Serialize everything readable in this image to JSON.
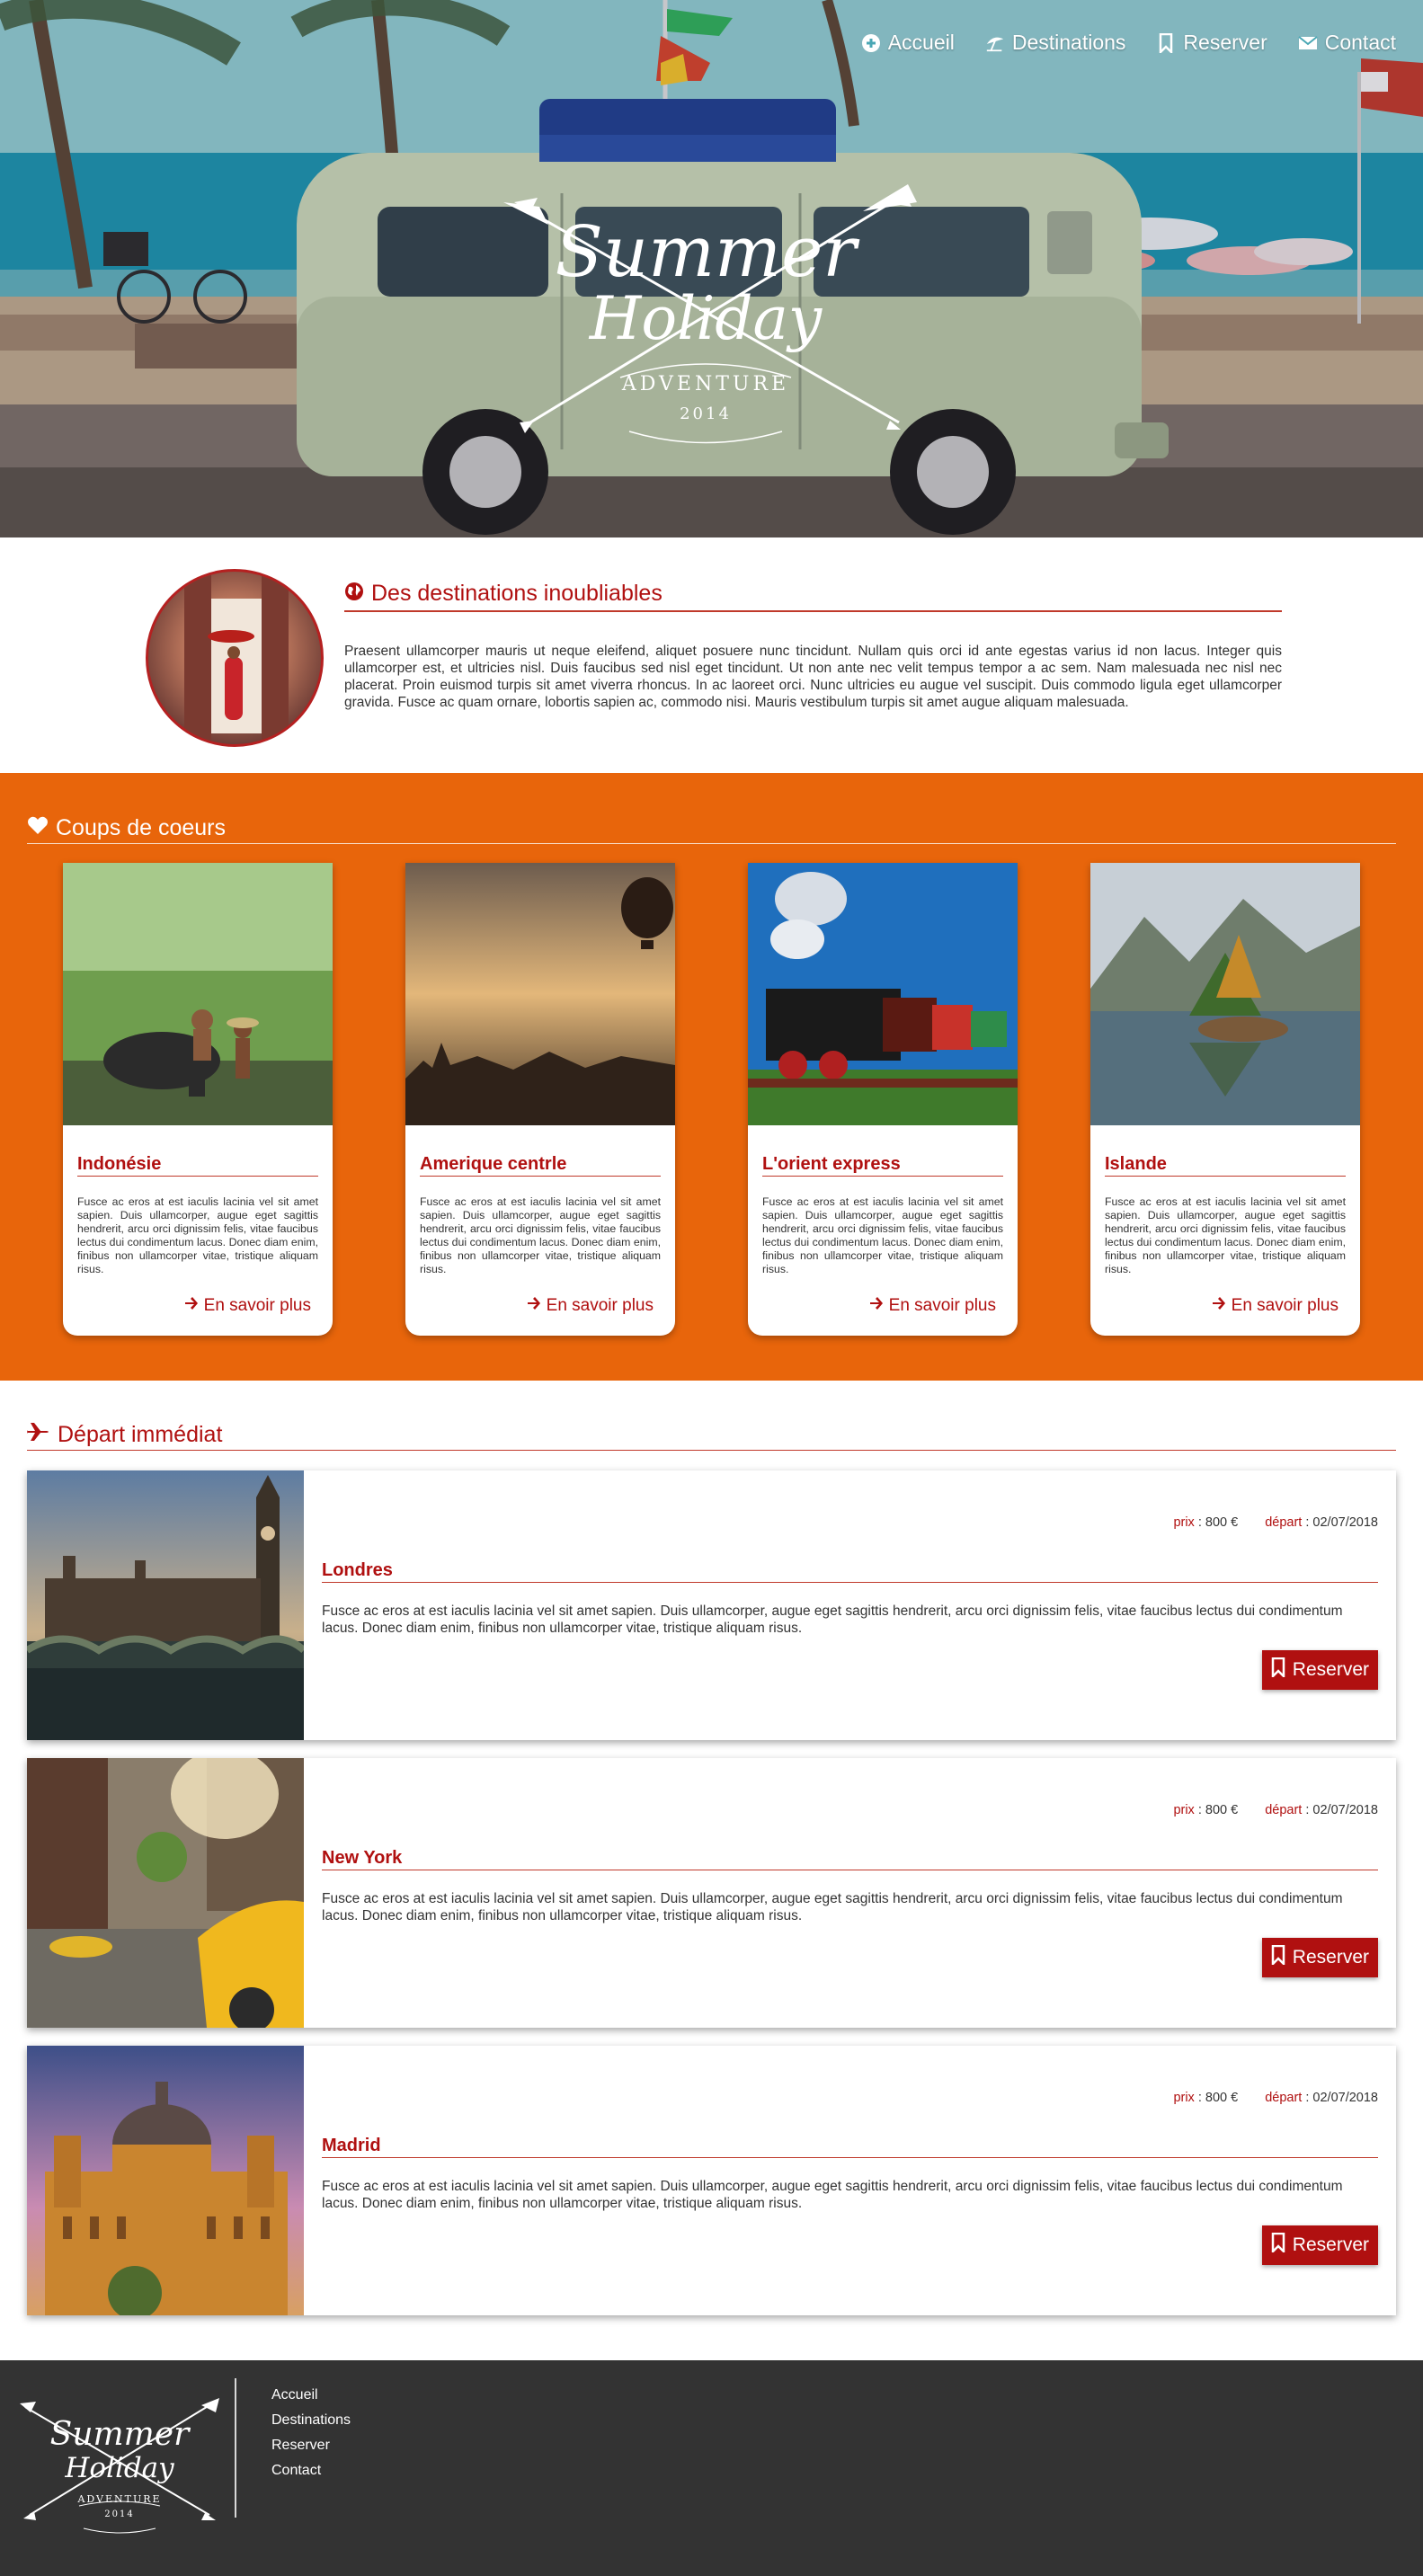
{
  "nav": {
    "items": [
      {
        "label": "Accueil",
        "icon": "plus-circle-icon"
      },
      {
        "label": "Destinations",
        "icon": "beach-umbrella-icon"
      },
      {
        "label": "Reserver",
        "icon": "bookmark-icon"
      },
      {
        "label": "Contact",
        "icon": "envelope-icon"
      }
    ]
  },
  "logo": {
    "line1": "Summer",
    "line2": "Holiday",
    "line3": "ADVENTURE",
    "line4": "2014"
  },
  "intro": {
    "title": "Des destinations inoubliables",
    "text": "Praesent ullamcorper mauris ut neque eleifend, aliquet posuere nunc tincidunt. Nullam quis orci id ante egestas varius id non lacus. Integer quis ullamcorper est, et ultricies nisl. Duis faucibus sed nisl eget tincidunt. Ut non ante nec velit tempus tempor a ac sem. Nam malesuada nec nisl nec placerat. Proin euismod turpis sit amet viverra rhoncus. In ac laoreet orci. Nunc ultricies eu augue vel suscipit. Duis commodo ligula eget ullamcorper gravida. Fusce ac quam ornare, lobortis sapien ac, commodo nisi. Mauris vestibulum turpis sit amet augue aliquam malesuada."
  },
  "coups": {
    "title": "Coups de coeurs",
    "more_label": "En savoir plus",
    "cards": [
      {
        "title": "Indonésie",
        "text": "Fusce ac eros at est iaculis lacinia vel sit amet sapien. Duis ullamcorper, augue eget sagittis hendrerit, arcu orci dignissim felis, vitae faucibus lectus dui condimentum lacus. Donec diam enim, finibus non ullamcorper vitae, tristique aliquam risus."
      },
      {
        "title": "Amerique centrle",
        "text": "Fusce ac eros at est iaculis lacinia vel sit amet sapien. Duis ullamcorper, augue eget sagittis hendrerit, arcu orci dignissim felis, vitae faucibus lectus dui condimentum lacus. Donec diam enim, finibus non ullamcorper vitae, tristique aliquam risus."
      },
      {
        "title": "L'orient express",
        "text": "Fusce ac eros at est iaculis lacinia vel sit amet sapien. Duis ullamcorper, augue eget sagittis hendrerit, arcu orci dignissim felis, vitae faucibus lectus dui condimentum lacus. Donec diam enim, finibus non ullamcorper vitae, tristique aliquam risus."
      },
      {
        "title": "Islande",
        "text": "Fusce ac eros at est iaculis lacinia vel sit amet sapien. Duis ullamcorper, augue eget sagittis hendrerit, arcu orci dignissim felis, vitae faucibus lectus dui condimentum lacus. Donec diam enim, finibus non ullamcorper vitae, tristique aliquam risus."
      }
    ]
  },
  "depart": {
    "title": "Départ immédiat",
    "price_key": "prix",
    "date_key": "départ",
    "button_label": "Reserver",
    "rows": [
      {
        "title": "Londres",
        "price": "800 €",
        "date": "02/07/2018",
        "text": "Fusce ac eros at est iaculis lacinia vel sit amet sapien. Duis ullamcorper, augue eget sagittis hendrerit, arcu orci dignissim felis, vitae faucibus lectus dui condimentum lacus. Donec diam enim, finibus non ullamcorper vitae, tristique aliquam risus."
      },
      {
        "title": "New York",
        "price": "800 €",
        "date": "02/07/2018",
        "text": "Fusce ac eros at est iaculis lacinia vel sit amet sapien. Duis ullamcorper, augue eget sagittis hendrerit, arcu orci dignissim felis, vitae faucibus lectus dui condimentum lacus. Donec diam enim, finibus non ullamcorper vitae, tristique aliquam risus."
      },
      {
        "title": "Madrid",
        "price": "800 €",
        "date": "02/07/2018",
        "text": "Fusce ac eros at est iaculis lacinia vel sit amet sapien. Duis ullamcorper, augue eget sagittis hendrerit, arcu orci dignissim felis, vitae faucibus lectus dui condimentum lacus. Donec diam enim, finibus non ullamcorper vitae, tristique aliquam risus."
      }
    ]
  },
  "footer": {
    "links": [
      "Accueil",
      "Destinations",
      "Reserver",
      "Contact"
    ]
  },
  "colors": {
    "accent": "#b01010",
    "orange": "#e8650b",
    "footer": "#333333"
  }
}
